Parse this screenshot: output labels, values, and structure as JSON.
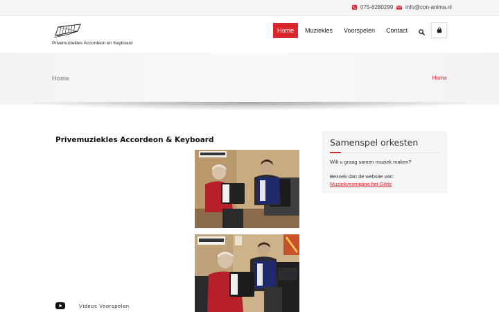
{
  "topbar": {
    "phone": "075-6280299",
    "email": "info@con-anima.nl"
  },
  "header": {
    "logo_caption": "Privemuziekles Accordeon en Keyboard",
    "nav": [
      {
        "label": "Home",
        "active": true
      },
      {
        "label": "Muziekles",
        "active": false
      },
      {
        "label": "Voorspelen",
        "active": false
      },
      {
        "label": "Contact",
        "active": false
      }
    ],
    "icons": {
      "search": "search-icon",
      "cart": "shopping-bag-icon"
    },
    "accent_color": "#d9262f"
  },
  "page_title": {
    "title": "Home",
    "breadcrumb": "Home"
  },
  "main": {
    "heading": "Privemuziekles Accordeon & Keyboard",
    "video_label": "Videos Voorspelen",
    "video_icon": "youtube-icon"
  },
  "sidebar": {
    "title": "Samenspel orkesten",
    "question": "Wilt u graag samen muziek maken?",
    "visit_text": "Bezoek dan de website van:",
    "link_text": "Muziekvereniging het Gilde"
  }
}
